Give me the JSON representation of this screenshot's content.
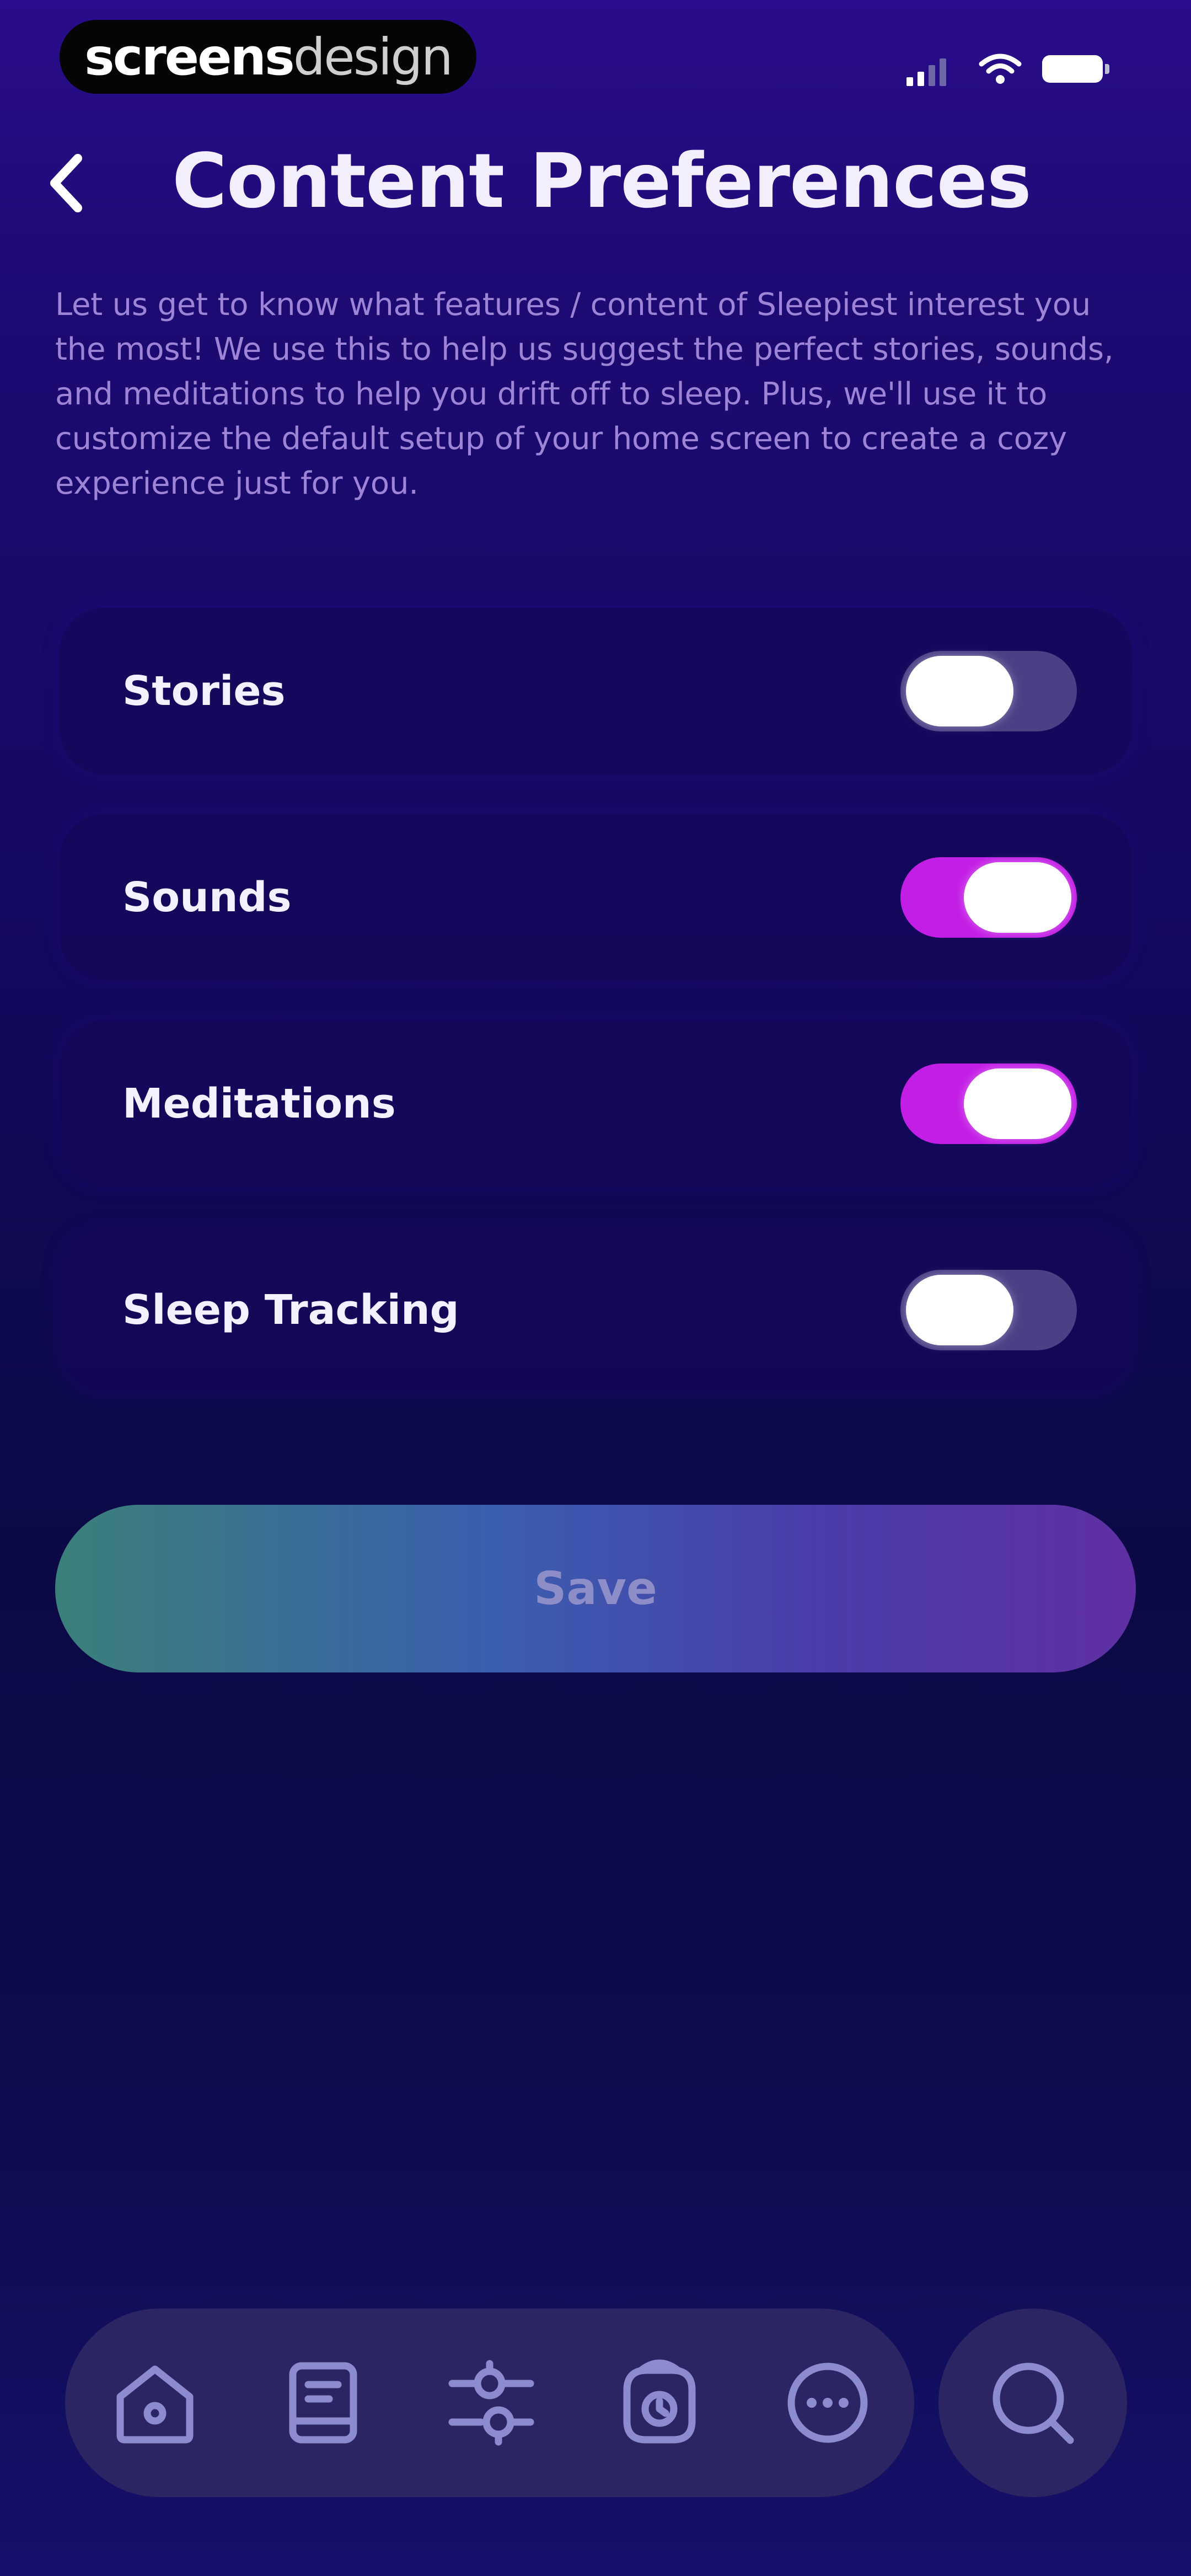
{
  "watermark": {
    "part1": "screens",
    "part2": "design"
  },
  "header": {
    "title": "Content Preferences"
  },
  "intro": {
    "text": "Let us get to know what features / content of Sleepiest interest you the most! We use this to help us suggest the perfect stories, sounds, and meditations to help you drift off to sleep. Plus, we'll use it to customize the default setup of your home screen to create a cozy experience just for you."
  },
  "preferences": [
    {
      "label": "Stories",
      "enabled": false
    },
    {
      "label": "Sounds",
      "enabled": true
    },
    {
      "label": "Meditations",
      "enabled": true
    },
    {
      "label": "Sleep Tracking",
      "enabled": false
    }
  ],
  "save_button": {
    "label": "Save"
  },
  "bottom_nav": {
    "items": [
      {
        "icon": "home-icon"
      },
      {
        "icon": "library-book-icon"
      },
      {
        "icon": "sliders-icon"
      },
      {
        "icon": "alarm-clock-icon"
      },
      {
        "icon": "more-icon"
      }
    ],
    "search_icon": "search-icon"
  },
  "colors": {
    "toggle_on": "#c31ee6",
    "toggle_off": "#4c3f86",
    "description_text": "#9d84d7",
    "nav_icon": "#8c8bd0"
  }
}
